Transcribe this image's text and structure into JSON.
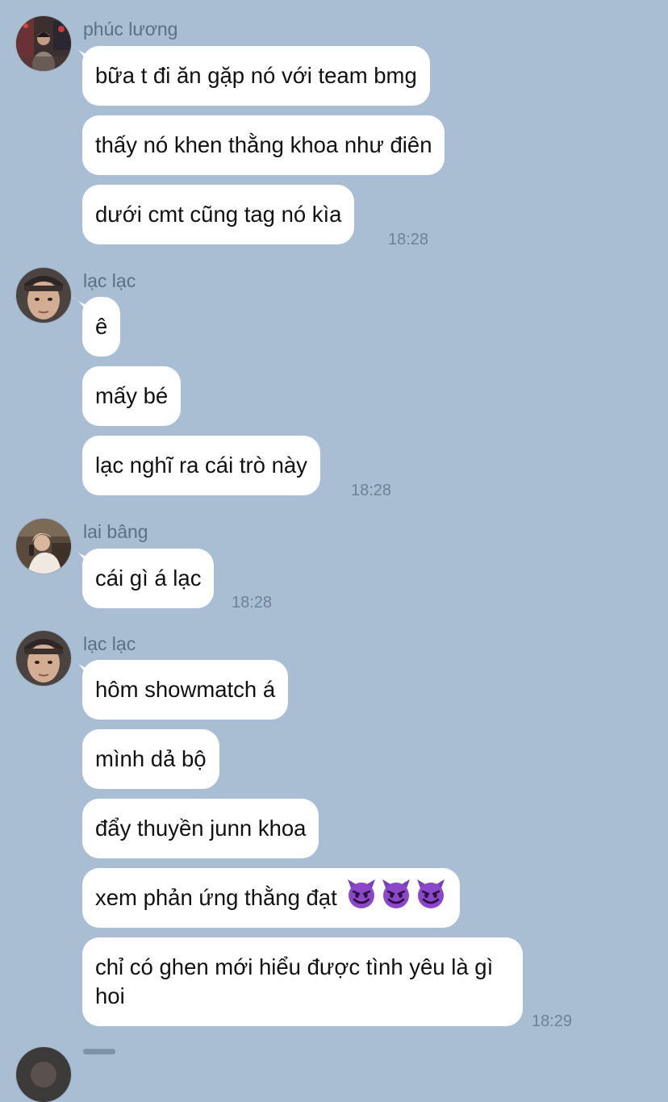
{
  "colors": {
    "background": "#a9bed3",
    "bubble": "#ffffff",
    "sender_text": "#5c6f83",
    "timestamp_text": "#6f8194",
    "message_text": "#111111",
    "emoji_purple": "#7b3fb8"
  },
  "groups": [
    {
      "sender": "phúc lương",
      "avatar": "avatar-phuc-luong",
      "messages": [
        "bữa t đi ăn gặp nó với team bmg",
        "thấy nó khen thằng khoa như điên",
        "dưới cmt cũng tag nó kìa"
      ],
      "time": "18:28"
    },
    {
      "sender": "lạc lạc",
      "avatar": "avatar-lac-lac",
      "messages": [
        "ê",
        "mấy bé",
        "lạc nghĩ ra cái trò này"
      ],
      "time": "18:28"
    },
    {
      "sender": "lai bâng",
      "avatar": "avatar-lai-bang",
      "messages": [
        "cái gì á lạc"
      ],
      "time": "18:28"
    },
    {
      "sender": "lạc lạc",
      "avatar": "avatar-lac-lac",
      "messages": [
        "hôm showmatch á",
        "mình dả bộ",
        "đẩy thuyền junn khoa",
        "xem phản ứng thằng đạt",
        "chỉ có ghen mới hiểu được tình yêu là gì hoi"
      ],
      "emoji": [
        "smiling-devil-emoji",
        "smiling-devil-emoji",
        "smiling-devil-emoji"
      ],
      "time": "18:29"
    }
  ]
}
